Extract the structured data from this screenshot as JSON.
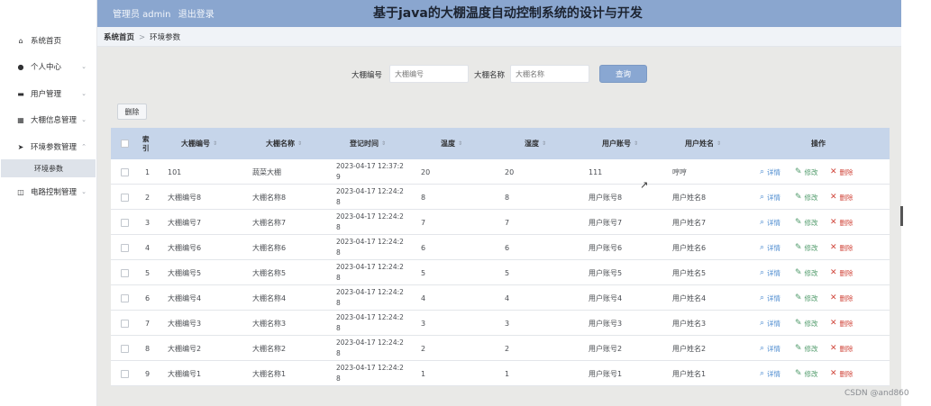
{
  "header": {
    "user_label": "管理员 admin",
    "logout_label": "退出登录",
    "title": "基于java的大棚温度自动控制系统的设计与开发"
  },
  "sidebar": {
    "items": [
      {
        "label": "系统首页",
        "icon": "home-icon",
        "has_arrow": false
      },
      {
        "label": "个人中心",
        "icon": "user-icon",
        "has_arrow": true
      },
      {
        "label": "用户管理",
        "icon": "briefcase-icon",
        "has_arrow": true
      },
      {
        "label": "大棚信息管理",
        "icon": "grid-icon",
        "has_arrow": true
      },
      {
        "label": "环境参数管理",
        "icon": "send-icon",
        "has_arrow": true,
        "expanded": true
      },
      {
        "label": "电路控制管理",
        "icon": "database-icon",
        "has_arrow": true
      }
    ],
    "active_sub": "环境参数"
  },
  "breadcrumb": {
    "home": "系统首页",
    "current": "环境参数"
  },
  "search": {
    "field1_label": "大棚编号",
    "field1_placeholder": "大棚编号",
    "field2_label": "大棚名称",
    "field2_placeholder": "大棚名称",
    "button_label": "查询"
  },
  "toolbar": {
    "delete_label": "删除"
  },
  "table": {
    "headers": {
      "index": "索\n引",
      "greenhouse_no": "大棚编号",
      "greenhouse_name": "大棚名称",
      "register_time": "登记时间",
      "temperature": "温度",
      "humidity": "湿度",
      "user_account": "用户账号",
      "user_name": "用户姓名",
      "actions": "操作"
    },
    "rows": [
      {
        "index": "1",
        "greenhouse_no": "101",
        "greenhouse_name": "蔬菜大棚",
        "register_time": "2023-04-17 12:37:2\n9",
        "temperature": "20",
        "humidity": "20",
        "user_account": "111",
        "user_name": "哼哼"
      },
      {
        "index": "2",
        "greenhouse_no": "大棚编号8",
        "greenhouse_name": "大棚名称8",
        "register_time": "2023-04-17 12:24:2\n8",
        "temperature": "8",
        "humidity": "8",
        "user_account": "用户账号8",
        "user_name": "用户姓名8"
      },
      {
        "index": "3",
        "greenhouse_no": "大棚编号7",
        "greenhouse_name": "大棚名称7",
        "register_time": "2023-04-17 12:24:2\n8",
        "temperature": "7",
        "humidity": "7",
        "user_account": "用户账号7",
        "user_name": "用户姓名7"
      },
      {
        "index": "4",
        "greenhouse_no": "大棚编号6",
        "greenhouse_name": "大棚名称6",
        "register_time": "2023-04-17 12:24:2\n8",
        "temperature": "6",
        "humidity": "6",
        "user_account": "用户账号6",
        "user_name": "用户姓名6"
      },
      {
        "index": "5",
        "greenhouse_no": "大棚编号5",
        "greenhouse_name": "大棚名称5",
        "register_time": "2023-04-17 12:24:2\n8",
        "temperature": "5",
        "humidity": "5",
        "user_account": "用户账号5",
        "user_name": "用户姓名5"
      },
      {
        "index": "6",
        "greenhouse_no": "大棚编号4",
        "greenhouse_name": "大棚名称4",
        "register_time": "2023-04-17 12:24:2\n8",
        "temperature": "4",
        "humidity": "4",
        "user_account": "用户账号4",
        "user_name": "用户姓名4"
      },
      {
        "index": "7",
        "greenhouse_no": "大棚编号3",
        "greenhouse_name": "大棚名称3",
        "register_time": "2023-04-17 12:24:2\n8",
        "temperature": "3",
        "humidity": "3",
        "user_account": "用户账号3",
        "user_name": "用户姓名3"
      },
      {
        "index": "8",
        "greenhouse_no": "大棚编号2",
        "greenhouse_name": "大棚名称2",
        "register_time": "2023-04-17 12:24:2\n8",
        "temperature": "2",
        "humidity": "2",
        "user_account": "用户账号2",
        "user_name": "用户姓名2"
      },
      {
        "index": "9",
        "greenhouse_no": "大棚编号1",
        "greenhouse_name": "大棚名称1",
        "register_time": "2023-04-17 12:24:2\n8",
        "temperature": "1",
        "humidity": "1",
        "user_account": "用户账号1",
        "user_name": "用户姓名1"
      }
    ],
    "action_labels": {
      "detail": "详情",
      "edit": "修改",
      "delete": "删除"
    }
  },
  "watermark": "CSDN @and860",
  "colors": {
    "header_bg": "#8aa6cf",
    "table_header_bg": "#c6d5ea",
    "button_bg": "#89a7d2",
    "detail": "#4c8bd0",
    "edit": "#4f9a6a",
    "delete": "#d0453a"
  }
}
